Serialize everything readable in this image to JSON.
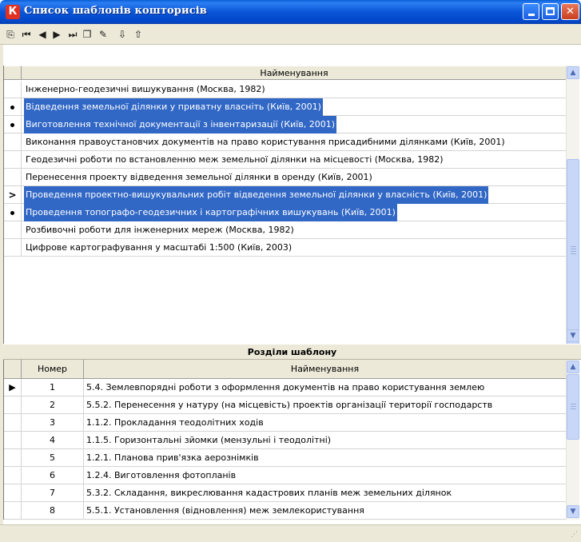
{
  "window": {
    "title": "Список шаблонів кошторисів",
    "app_icon": "К"
  },
  "toolbar": {
    "tools": [
      {
        "name": "new-record-icon",
        "glyph": "⎘"
      },
      {
        "name": "first-record-icon",
        "glyph": "⏮"
      },
      {
        "name": "prev-record-icon",
        "glyph": "◀"
      },
      {
        "name": "next-record-icon",
        "glyph": "▶"
      },
      {
        "name": "last-record-icon",
        "glyph": "⏭"
      },
      {
        "name": "copy-record-icon",
        "glyph": "❐"
      },
      {
        "name": "edit-record-icon",
        "glyph": "✎"
      },
      {
        "name": "import-icon",
        "glyph": "⇩"
      },
      {
        "name": "export-icon",
        "glyph": "⇧"
      }
    ]
  },
  "templates": {
    "header": "Найменування",
    "rows": [
      {
        "text": "Інженерно-геодезичні вишукування (Москва, 1982)",
        "selected": false,
        "marker": ""
      },
      {
        "text": "Відведення земельної ділянки у приватну власніть (Київ, 2001)",
        "selected": true,
        "marker": "dot"
      },
      {
        "text": "Виготовлення технічної документації з інвентаризації (Київ, 2001)",
        "selected": true,
        "marker": "dot"
      },
      {
        "text": "Виконання правоустановчих документів на право користування присадибними ділянками (Київ, 2001)",
        "selected": false,
        "marker": ""
      },
      {
        "text": "Геодезичні роботи по встановленню меж земельної ділянки на місцевості (Москва, 1982)",
        "selected": false,
        "marker": ""
      },
      {
        "text": "Перенесення проекту відведення земельної ділянки в оренду (Київ, 2001)",
        "selected": false,
        "marker": ""
      },
      {
        "text": "Проведення проектно-вишукувальних робіт відведення земельної ділянки у власність (Київ, 2001)",
        "selected": true,
        "marker": "current"
      },
      {
        "text": "Проведення топографо-геодезичних і картографічних вишукувань (Київ, 2001)",
        "selected": true,
        "marker": "dot"
      },
      {
        "text": "Розбивочні роботи для інженерних мереж (Москва, 1982)",
        "selected": false,
        "marker": ""
      },
      {
        "text": "Цифрове картографування у масштабі 1:500 (Київ, 2003)",
        "selected": false,
        "marker": ""
      }
    ]
  },
  "sections": {
    "title": "Розділи шаблону",
    "headers": {
      "number": "Номер",
      "name": "Найменування"
    },
    "rows": [
      {
        "number": "1",
        "name": "5.4. Землевпорядні роботи з оформлення документів на право користування землею",
        "current": true
      },
      {
        "number": "2",
        "name": "5.5.2. Перенесення у натуру (на місцевість) проектів організації території господарств",
        "current": false
      },
      {
        "number": "3",
        "name": "1.1.2. Прокладання теодолітних ходів",
        "current": false
      },
      {
        "number": "4",
        "name": "1.1.5. Горизонтальні зйомки (мензульні і теодолітні)",
        "current": false
      },
      {
        "number": "5",
        "name": "1.2.1. Планова прив'язка аерознімків",
        "current": false
      },
      {
        "number": "6",
        "name": "1.2.4. Виготовлення фотопланів",
        "current": false
      },
      {
        "number": "7",
        "name": "5.3.2. Складання, викреслювання кадастрових планів меж земельних ділянок",
        "current": false
      },
      {
        "number": "8",
        "name": "5.5.1. Установлення (відновлення) меж землекористування",
        "current": false
      }
    ]
  },
  "colors": {
    "selection": "#3167c5",
    "titlebar": "#0a55d8"
  }
}
